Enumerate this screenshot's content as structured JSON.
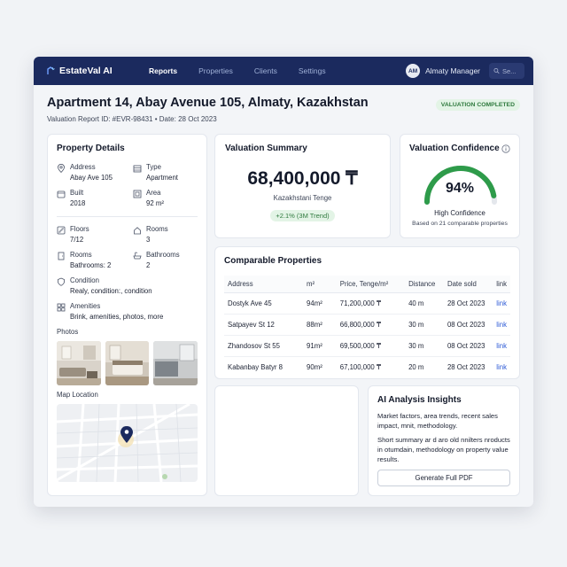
{
  "app": {
    "name": "EstateVal AI"
  },
  "nav": {
    "tabs": [
      {
        "label": "Reports"
      },
      {
        "label": "Properties"
      },
      {
        "label": "Clients"
      },
      {
        "label": "Settings"
      }
    ],
    "active_tab": "Reports",
    "user": {
      "initials": "AM",
      "name": "Almaty Manager"
    },
    "search_placeholder": "Se..."
  },
  "header": {
    "title": "Apartment 14, Abay Avenue 105, Almaty, Kazakhstan",
    "subtitle": "Valuation Report ID: #EVR-98431 • Date: 28 Oct 2023",
    "status": "VALUATION COMPLETED"
  },
  "details": {
    "title": "Property Details",
    "address_label": "Address",
    "address_value": "Abay Ave 105",
    "type_label": "Type",
    "type_value": "Apartment",
    "built_label": "Built",
    "built_value": "2018",
    "area_label": "Area",
    "area_value": "92 m²",
    "floors_label": "Floors",
    "floors_value": "7/12",
    "rooms_label": "Rooms",
    "rooms_value": "3",
    "rooms2_label": "Rooms",
    "rooms2_value": "Bathrooms: 2",
    "bathrooms_label": "Bathrooms",
    "bathrooms_value": "2",
    "condition_label": "Condition",
    "condition_value": "Realy, condition:, condition",
    "amenities_label": "Amenities",
    "amenities_value": "Brink, amenities, photos, more",
    "photos_label": "Photos",
    "map_label": "Map Location"
  },
  "summary": {
    "title": "Valuation Summary",
    "value": "68,400,000 ₸",
    "currency": "Kazakhstani Tenge",
    "trend": "+2.1% (3M Trend)"
  },
  "confidence": {
    "title": "Valuation Confidence",
    "value": "94%",
    "percent": 94,
    "label": "High Confidence",
    "sub": "Based on 21 comparable properties"
  },
  "comparables": {
    "title": "Comparable Properties",
    "headers": [
      "Address",
      "m²",
      "Price, Tenge/m²",
      "Distance",
      "Date sold",
      "link"
    ],
    "rows": [
      [
        "Dostyk Ave 45",
        "94m²",
        "71,200,000 ₸",
        "40 m",
        "28 Oct 2023",
        "link"
      ],
      [
        "Satpayev St 12",
        "88m²",
        "66,800,000 ₸",
        "30 m",
        "08 Oct 2023",
        "link"
      ],
      [
        "Zhandosov St 55",
        "91m²",
        "69,500,000 ₸",
        "30 m",
        "08 Oct 2023",
        "link"
      ],
      [
        "Kabanbay Batyr 8",
        "90m²",
        "67,100,000 ₸",
        "20 m",
        "28 Oct 2023",
        "link"
      ]
    ]
  },
  "insights": {
    "title": "AI Analysis Insights",
    "text1": "Market factors, area trends, recent sales impact, mnit, methodology.",
    "text2": "Short summary ar d aro old nnilters nroducts in otumdain, methodology on property value results.",
    "button": "Generate Full PDF"
  },
  "colors": {
    "nav_bg": "#1b2a5e",
    "accent_green": "#2e9b4a",
    "link_blue": "#2e5bd6"
  }
}
